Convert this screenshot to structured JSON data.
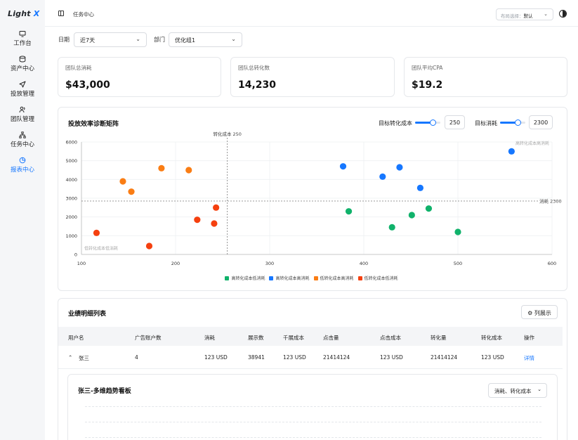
{
  "app": {
    "logo_text": "Light",
    "logo_accent": "X"
  },
  "sidebar": {
    "items": [
      {
        "label": "工作台",
        "icon": "monitor-icon",
        "active": false
      },
      {
        "label": "资产中心",
        "icon": "database-icon",
        "active": false
      },
      {
        "label": "投放管理",
        "icon": "send-icon",
        "active": false
      },
      {
        "label": "团队管理",
        "icon": "users-icon",
        "active": false
      },
      {
        "label": "任务中心",
        "icon": "sitemap-icon",
        "active": false
      },
      {
        "label": "报表中心",
        "icon": "chart-circle-icon",
        "active": true
      }
    ]
  },
  "header": {
    "title": "任务中心",
    "layout_label": "布局选择：",
    "layout_value": "默认"
  },
  "filters": {
    "date_label": "日期",
    "date_value": "近7天",
    "dept_label": "部门",
    "dept_value": "优化组1"
  },
  "stats": [
    {
      "label": "团队总消耗",
      "value": "$43,000"
    },
    {
      "label": "团队总转化数",
      "value": "14,230"
    },
    {
      "label": "团队平均CPA",
      "value": "$19.2"
    }
  ],
  "matrix": {
    "title": "投放效率诊断矩阵",
    "target_cost_label": "目标转化成本",
    "target_cost_value": "250",
    "target_spend_label": "目标消耗",
    "target_spend_value": "2300",
    "slider_cost_fraction": 0.7,
    "slider_spend_fraction": 0.7
  },
  "chart_data": {
    "type": "scatter",
    "xlim": [
      100,
      600
    ],
    "ylim": [
      0,
      6000
    ],
    "x_ticks": [
      "100",
      "200",
      "300",
      "400",
      "500",
      "600"
    ],
    "y_ticks": [
      "0",
      "1000",
      "2000",
      "3000",
      "4000",
      "5000",
      "6000"
    ],
    "vline": {
      "x": 255,
      "label": "转化成本 250"
    },
    "hline": {
      "y": 2850,
      "label": "消耗 2300"
    },
    "quadrant_labels": {
      "top_right": "高转化成本高消耗",
      "bottom_left": "低转化成本低消耗"
    },
    "grid": true,
    "legend_position": "bottom-center",
    "series": [
      {
        "name": "高转化成本低消耗",
        "color": "#10b26b",
        "points": [
          [
            384,
            2300
          ],
          [
            430,
            1450
          ],
          [
            451,
            2100
          ],
          [
            469,
            2450
          ],
          [
            500,
            1200
          ]
        ]
      },
      {
        "name": "高转化成本高消耗",
        "color": "#1677ff",
        "points": [
          [
            378,
            4700
          ],
          [
            420,
            4150
          ],
          [
            438,
            4650
          ],
          [
            460,
            3550
          ],
          [
            557,
            5500
          ]
        ]
      },
      {
        "name": "低转化成本高消耗",
        "color": "#fa7d14",
        "points": [
          [
            144,
            3900
          ],
          [
            153,
            3350
          ],
          [
            185,
            4600
          ],
          [
            214,
            4500
          ]
        ]
      },
      {
        "name": "低转化成本低消耗",
        "color": "#f5400f",
        "points": [
          [
            116,
            1150
          ],
          [
            172,
            450
          ],
          [
            223,
            1850
          ],
          [
            241,
            1650
          ],
          [
            243,
            2500
          ]
        ]
      }
    ]
  },
  "table": {
    "title": "业绩明细列表",
    "columns_button": "列展示",
    "headers": [
      "用户名",
      "广告账户数",
      "消耗",
      "展示数",
      "千展成本",
      "点击量",
      "点击成本",
      "转化量",
      "转化成本",
      "操作"
    ],
    "rows": [
      [
        "张三",
        "4",
        "123 USD",
        "38941",
        "123 USD",
        "21414124",
        "123 USD",
        "21414124",
        "123 USD",
        "详情"
      ]
    ]
  },
  "trend": {
    "title": "张三-多维趋势看板",
    "select_value": "消耗、转化成本"
  }
}
